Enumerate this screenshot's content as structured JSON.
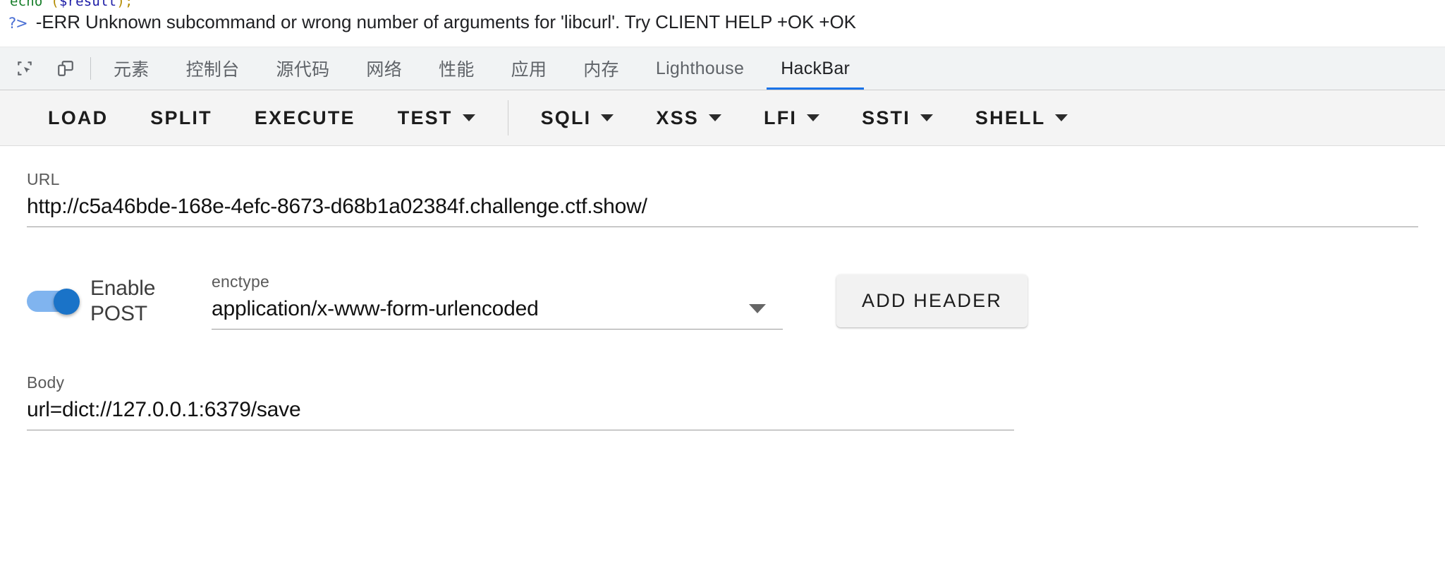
{
  "console": {
    "code_line": {
      "keyword": "echo",
      "open": " (",
      "variable": "$result",
      "close": ");"
    },
    "prompt_glyph": "?>",
    "error_message": "-ERR Unknown subcommand or wrong number of arguments for 'libcurl'. Try CLIENT HELP +OK +OK"
  },
  "devtools": {
    "icons": [
      {
        "name": "inspect-element-icon",
        "label": "检查元素"
      },
      {
        "name": "device-toolbar-icon",
        "label": "设备模拟"
      }
    ],
    "tabs": [
      {
        "label": "元素",
        "active": false
      },
      {
        "label": "控制台",
        "active": false
      },
      {
        "label": "源代码",
        "active": false
      },
      {
        "label": "网络",
        "active": false
      },
      {
        "label": "性能",
        "active": false
      },
      {
        "label": "应用",
        "active": false
      },
      {
        "label": "内存",
        "active": false
      },
      {
        "label": "Lighthouse",
        "active": false
      },
      {
        "label": "HackBar",
        "active": true
      }
    ],
    "active_tab_color": "#1a73e8"
  },
  "hackbar": {
    "toolbar": [
      {
        "label": "LOAD",
        "has_caret": false
      },
      {
        "label": "SPLIT",
        "has_caret": false
      },
      {
        "label": "EXECUTE",
        "has_caret": false
      },
      {
        "label": "TEST",
        "has_caret": true
      },
      {
        "label": "SQLI",
        "has_caret": true
      },
      {
        "label": "XSS",
        "has_caret": true
      },
      {
        "label": "LFI",
        "has_caret": true
      },
      {
        "label": "SSTI",
        "has_caret": true
      },
      {
        "label": "SHELL",
        "has_caret": true
      }
    ],
    "url": {
      "label": "URL",
      "value": "http://c5a46bde-168e-4efc-8673-d68b1a02384f.challenge.ctf.show/",
      "placeholder": "URL"
    },
    "post": {
      "toggle_label": "Enable POST",
      "toggle_on": true,
      "toggle_on_color": "#1a73c8",
      "toggle_track_color": "#80b4ef"
    },
    "enctype": {
      "label": "enctype",
      "value": "application/x-www-form-urlencoded"
    },
    "add_header": {
      "label": "ADD HEADER"
    },
    "body": {
      "label": "Body",
      "value": "url=dict://127.0.0.1:6379/save",
      "placeholder": "Body"
    }
  }
}
